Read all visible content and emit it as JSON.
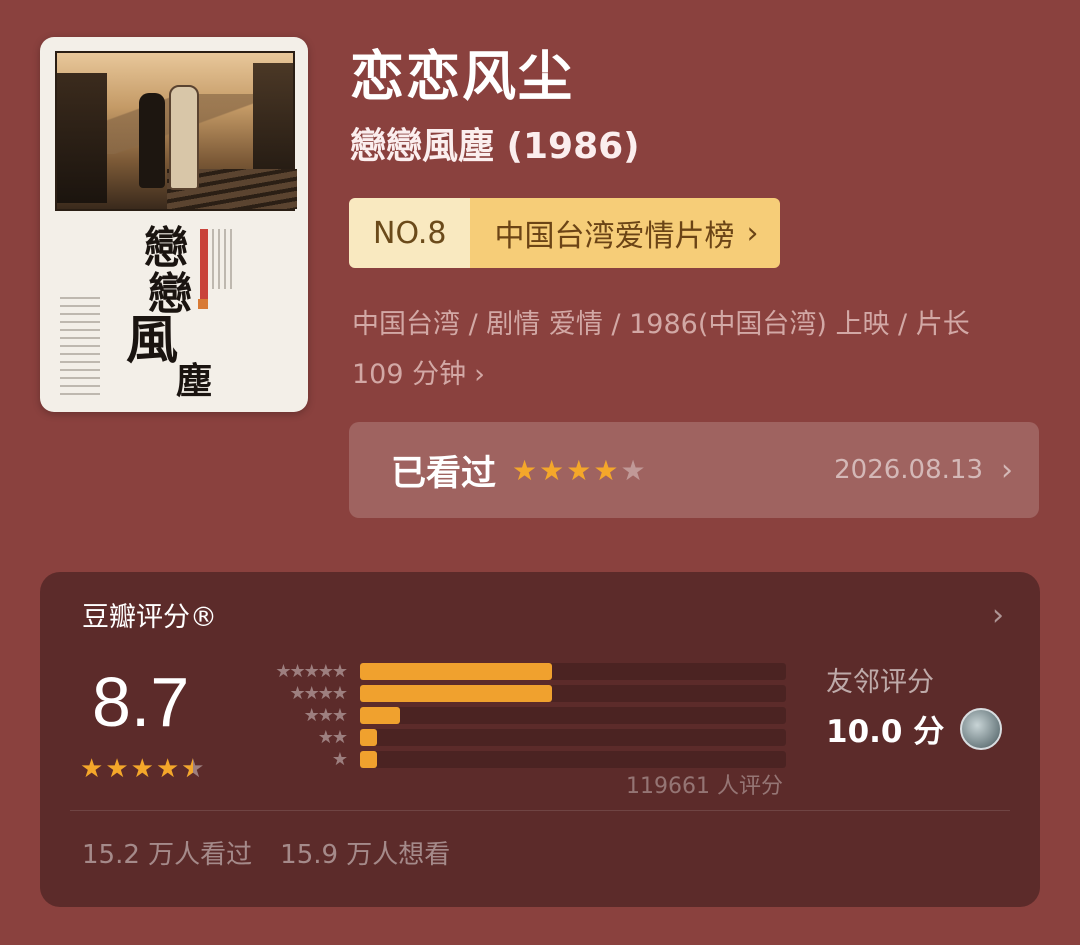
{
  "movie": {
    "title": "恋恋风尘",
    "original_title": "戀戀風塵 (1986)",
    "rank_no": "NO.8",
    "rank_label": "中国台湾爱情片榜",
    "meta_line1": "中国台湾 / 剧情 爱情 / 1986(中国台湾) 上映 / 片长",
    "meta_line2": "109 分钟",
    "poster_title_chars": [
      "戀",
      "戀",
      "風",
      "塵"
    ]
  },
  "watched": {
    "label": "已看过",
    "stars": 4,
    "max_stars": 5,
    "date": "2026.08.13"
  },
  "rating": {
    "heading": "豆瓣评分®",
    "score": "8.7",
    "stars": 4.5,
    "distribution": [
      {
        "stars": 5,
        "fraction": 0.45
      },
      {
        "stars": 4,
        "fraction": 0.45
      },
      {
        "stars": 3,
        "fraction": 0.095
      },
      {
        "stars": 2,
        "fraction": 0.04
      },
      {
        "stars": 1,
        "fraction": 0.04
      }
    ],
    "raters": "119661 人评分",
    "friends_label": "友邻评分",
    "friends_score": "10.0 分",
    "watched_count": "15.2 万人看过",
    "wish_count": "15.9 万人想看"
  },
  "colors": {
    "background": "#8a413e",
    "card": "#5c2b2a",
    "accent": "#f4a72a",
    "rank_bg": "#f6cd78"
  },
  "icons": {
    "chevron": "chevron-right-icon",
    "star": "star-icon"
  }
}
